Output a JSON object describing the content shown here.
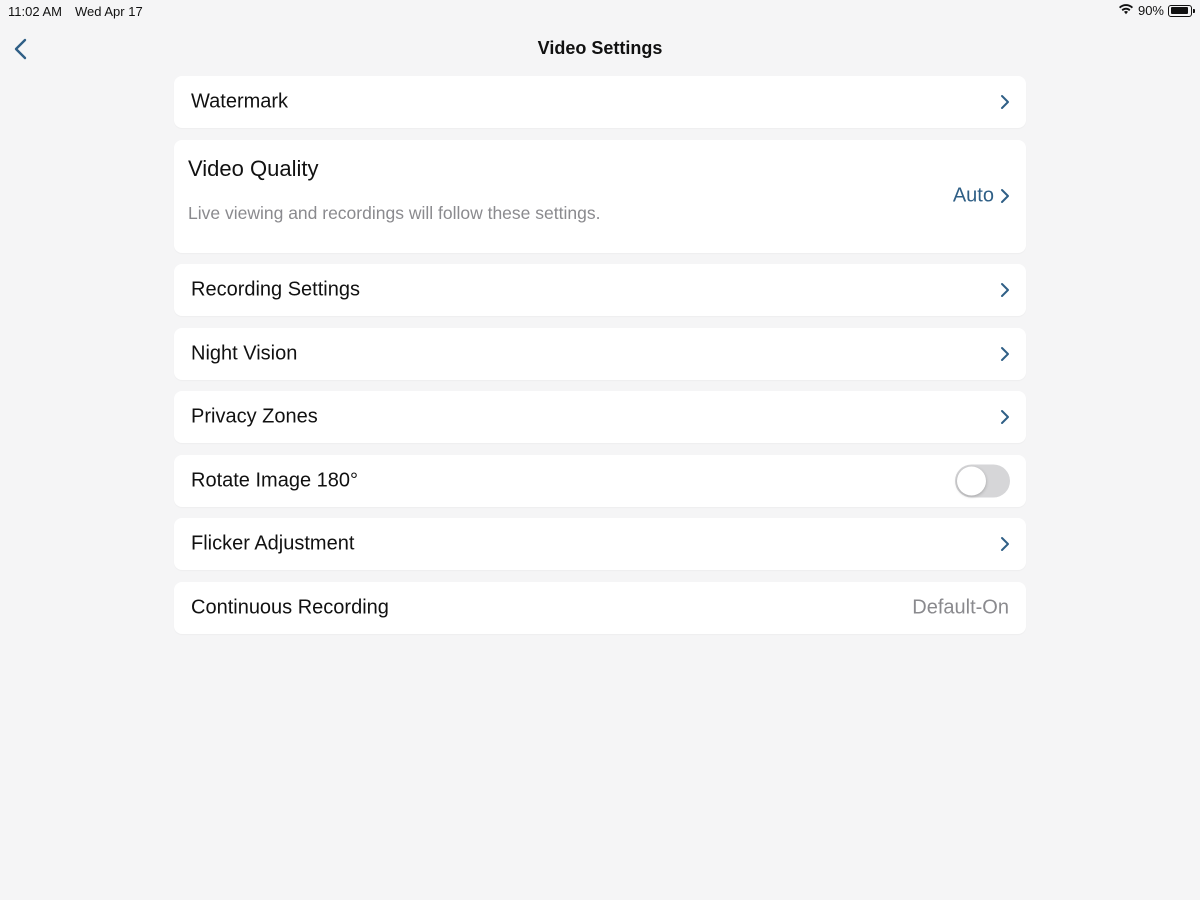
{
  "status_bar": {
    "time": "11:02 AM",
    "date": "Wed Apr 17",
    "battery_percent_label": "90%",
    "battery_level": 0.9,
    "wifi_icon": "wifi-icon",
    "battery_icon": "battery-icon"
  },
  "nav": {
    "title": "Video Settings",
    "back_icon": "chevron-left-icon"
  },
  "colors": {
    "accent": "#2f5f86",
    "secondary_text": "#8a8a8e",
    "background": "#f5f5f6",
    "card": "#ffffff"
  },
  "rows": {
    "watermark": {
      "label": "Watermark"
    },
    "video_quality": {
      "label": "Video Quality",
      "subtitle": "Live viewing and recordings will follow these settings.",
      "value": "Auto"
    },
    "recording_settings": {
      "label": "Recording Settings"
    },
    "night_vision": {
      "label": "Night Vision"
    },
    "privacy_zones": {
      "label": "Privacy Zones"
    },
    "rotate_image": {
      "label": "Rotate Image 180°",
      "toggle_on": false
    },
    "flicker_adjustment": {
      "label": "Flicker Adjustment"
    },
    "continuous_recording": {
      "label": "Continuous Recording",
      "value": "Default-On"
    }
  }
}
